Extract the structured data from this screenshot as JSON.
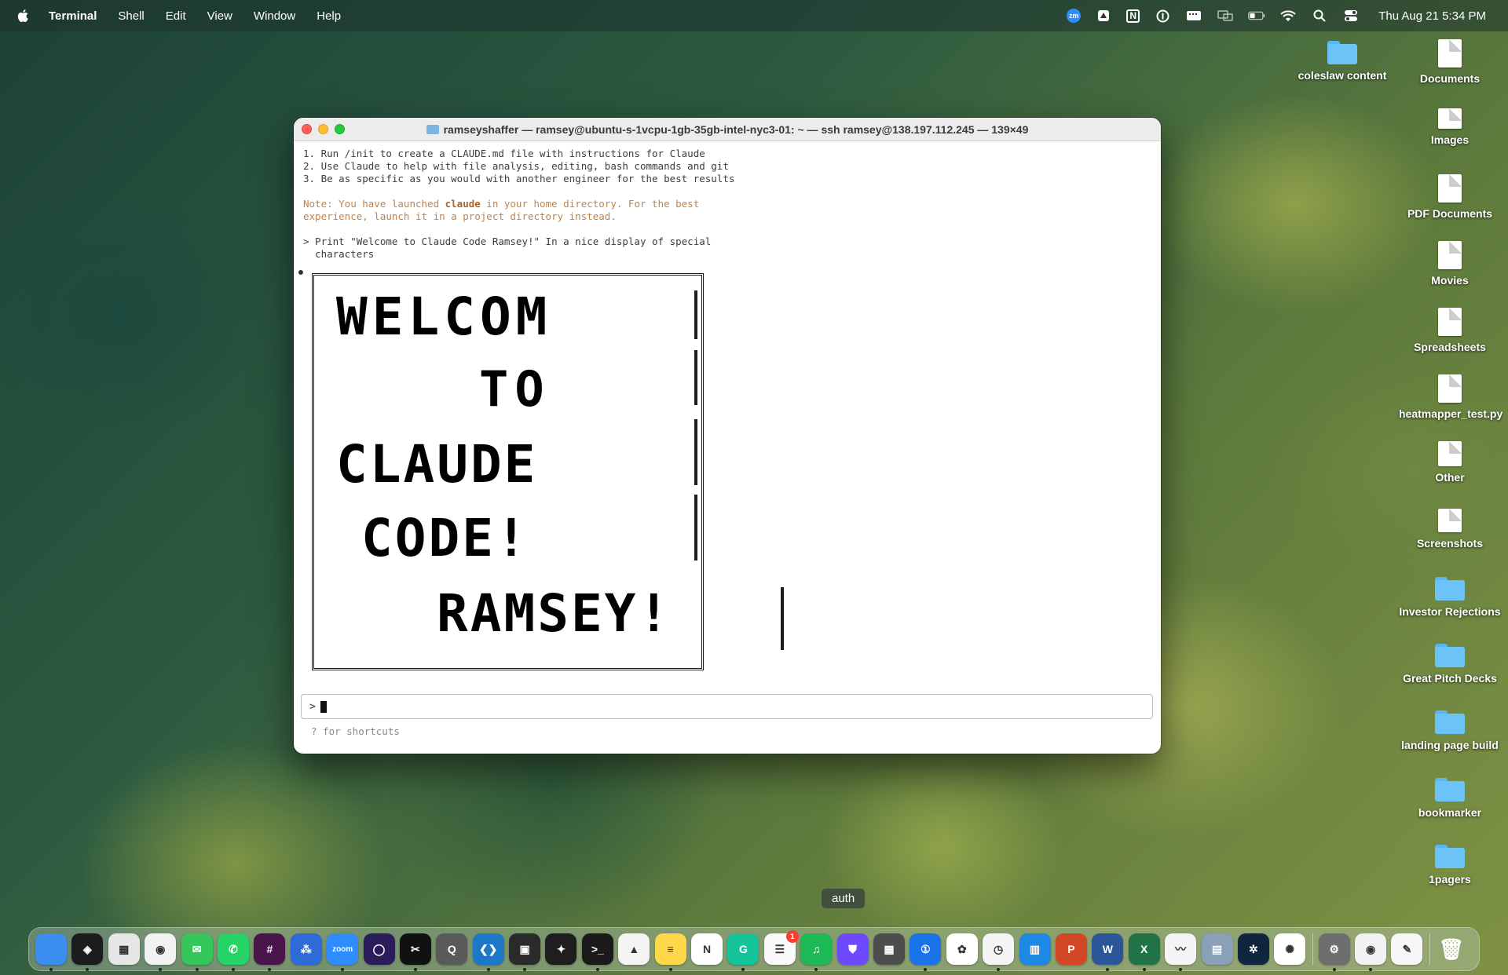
{
  "menubar": {
    "app_name": "Terminal",
    "items": [
      "Shell",
      "Edit",
      "View",
      "Window",
      "Help"
    ],
    "status_icons": [
      "zm",
      "",
      "N",
      "",
      "",
      "",
      "",
      "",
      "",
      ""
    ],
    "clock": "Thu Aug 21  5:34 PM"
  },
  "desktop": {
    "icons": [
      {
        "label": "coleslaw content",
        "kind": "folder"
      },
      {
        "label": "Documents",
        "kind": "file"
      },
      {
        "label": "Images",
        "kind": "file"
      },
      {
        "label": "PDF Documents",
        "kind": "file"
      },
      {
        "label": "Movies",
        "kind": "file"
      },
      {
        "label": "Spreadsheets",
        "kind": "file"
      },
      {
        "label": "heatmapper_test.py",
        "kind": "file"
      },
      {
        "label": "Other",
        "kind": "file"
      },
      {
        "label": "Screenshots",
        "kind": "file"
      },
      {
        "label": "Investor Rejections",
        "kind": "folder"
      },
      {
        "label": "Great Pitch Decks",
        "kind": "folder"
      },
      {
        "label": "landing page build",
        "kind": "folder"
      },
      {
        "label": "bookmarker",
        "kind": "folder"
      },
      {
        "label": "1pagers",
        "kind": "folder"
      }
    ]
  },
  "terminal": {
    "title": "ramseyshaffer — ramsey@ubuntu-s-1vcpu-1gb-35gb-intel-nyc3-01: ~ — ssh ramsey@138.197.112.245 — 139×49",
    "tips": [
      "1. Run /init to create a CLAUDE.md file with instructions for Claude",
      "2. Use Claude to help with file analysis, editing, bash commands and git",
      "3. Be as specific as you would with another engineer for the best results"
    ],
    "note_prefix": "Note: You have launched ",
    "note_bold": "claude",
    "note_suffix": " in your home directory. For the best",
    "note_line2": "experience, launch it in a project directory instead.",
    "user_prompt_line1": "> Print \"Welcome to Claude Code Ramsey!\" In a nice display of special",
    "user_prompt_line2": "  characters",
    "banner_lines": [
      "WELCOM",
      "TO",
      "CLAUDE",
      "CODE!",
      "RAMSEY!"
    ],
    "input_prompt": ">",
    "hint": "? for shortcuts"
  },
  "tooltip": "auth",
  "dock": {
    "apps": [
      {
        "name": "finder-icon",
        "color": "#3b8ef0",
        "glyph": ""
      },
      {
        "name": "layers-app-icon",
        "color": "#1c1c1c",
        "glyph": "◈"
      },
      {
        "name": "launchpad-icon",
        "color": "#e6e6e6",
        "glyph": "▦"
      },
      {
        "name": "chrome-icon",
        "color": "#f2f2f2",
        "glyph": "◉"
      },
      {
        "name": "messages-icon",
        "color": "#34c759",
        "glyph": "✉"
      },
      {
        "name": "whatsapp-icon",
        "color": "#25d366",
        "glyph": "✆"
      },
      {
        "name": "slack-icon",
        "color": "#4a154b",
        "glyph": "#"
      },
      {
        "name": "dots-app-icon",
        "color": "#2f6bd8",
        "glyph": "⁂"
      },
      {
        "name": "zoom-icon",
        "color": "#2d8cff",
        "glyph": "zoom"
      },
      {
        "name": "circle-app-icon",
        "color": "#2b1d5c",
        "glyph": "◯"
      },
      {
        "name": "capcut-icon",
        "color": "#111111",
        "glyph": "✂"
      },
      {
        "name": "quicktime-icon",
        "color": "#5a5a5a",
        "glyph": "Q"
      },
      {
        "name": "vscode-icon",
        "color": "#1e78c8",
        "glyph": "❮❯"
      },
      {
        "name": "cube-app-icon",
        "color": "#2a2a2a",
        "glyph": "▣"
      },
      {
        "name": "figma-icon",
        "color": "#1e1e1e",
        "glyph": "✦"
      },
      {
        "name": "terminal-icon",
        "color": "#1a1a1a",
        "glyph": ">_"
      },
      {
        "name": "google-drive-icon",
        "color": "#f4f4f4",
        "glyph": "▲"
      },
      {
        "name": "notes-icon",
        "color": "#ffd84a",
        "glyph": "≡"
      },
      {
        "name": "notion-icon",
        "color": "#ffffff",
        "glyph": "N"
      },
      {
        "name": "grammarly-icon",
        "color": "#15c39a",
        "glyph": "G"
      },
      {
        "name": "reminders-icon",
        "color": "#fafafa",
        "glyph": "☰"
      },
      {
        "name": "spotify-icon",
        "color": "#1db954",
        "glyph": "♫"
      },
      {
        "name": "vpn-icon",
        "color": "#6d4aff",
        "glyph": "⛊"
      },
      {
        "name": "calculator-icon",
        "color": "#4d4d4d",
        "glyph": "▦"
      },
      {
        "name": "1password-icon",
        "color": "#1a73e8",
        "glyph": "①"
      },
      {
        "name": "photos-icon",
        "color": "#ffffff",
        "glyph": "✿"
      },
      {
        "name": "clock-icon",
        "color": "#f5f5f5",
        "glyph": "◷"
      },
      {
        "name": "keynote-icon",
        "color": "#1e88e5",
        "glyph": "▥"
      },
      {
        "name": "powerpoint-icon",
        "color": "#d24726",
        "glyph": "P"
      },
      {
        "name": "word-icon",
        "color": "#2b579a",
        "glyph": "W"
      },
      {
        "name": "excel-icon",
        "color": "#217346",
        "glyph": "X"
      },
      {
        "name": "freeform-icon",
        "color": "#f5f5f5",
        "glyph": "〰"
      },
      {
        "name": "preview-icon",
        "color": "#8aa0b8",
        "glyph": "▤"
      },
      {
        "name": "butterfly-app-icon",
        "color": "#10253e",
        "glyph": "✲"
      },
      {
        "name": "chatgpt-icon",
        "color": "#ffffff",
        "glyph": "✺"
      }
    ],
    "apps_after_sep": [
      {
        "name": "system-settings-icon",
        "color": "#6e6e6e",
        "glyph": "⚙"
      },
      {
        "name": "chrome-secondary-icon",
        "color": "#f2f2f2",
        "glyph": "◉"
      },
      {
        "name": "textedit-icon",
        "color": "#f7f7f7",
        "glyph": "✎"
      }
    ],
    "trash": {
      "name": "trash-icon",
      "color": "transparent",
      "glyph": "🗑"
    }
  }
}
